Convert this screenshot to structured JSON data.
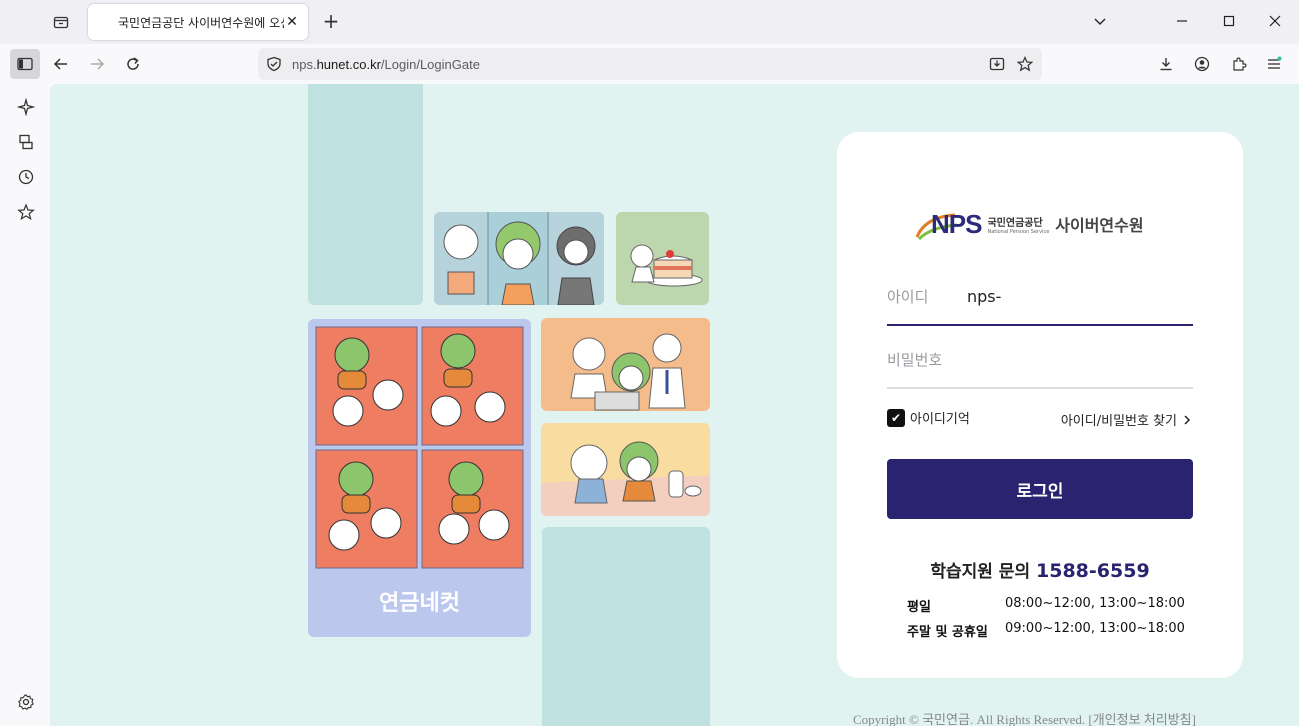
{
  "browser": {
    "tab_title": "국민연금공단 사이버연수원에 오신 것을 환영합니다",
    "url_prefix": "nps.",
    "url_host": "hunet.co.kr",
    "url_path": "/Login/LoginGate"
  },
  "comic": {
    "title": "연금네컷"
  },
  "login": {
    "logo_brand": "NPS",
    "logo_org_ko": "국민연금공단",
    "logo_org_en": "National Pension Service",
    "logo_title": "사이버연수원",
    "id_label": "아이디",
    "id_value": "nps-",
    "pw_label": "비밀번호",
    "remember_label": "아이디기억",
    "find_label": "아이디/비밀번호 찾기",
    "login_button": "로그인"
  },
  "support": {
    "label": "학습지원 문의",
    "phone": "1588-6559",
    "hours": [
      {
        "label": "평일",
        "time": "08:00~12:00, 13:00~18:00"
      },
      {
        "label": "주말 및 공휴일",
        "time": "09:00~12:00, 13:00~18:00"
      }
    ]
  },
  "footer": {
    "copyright": "Copyright © 국민연금. All Rights Reserved. [개인정보 처리방침]"
  },
  "colors": {
    "page_bg": "#e0f3f1",
    "accent": "#2a2370",
    "teal_tile": "#bfe1df"
  }
}
